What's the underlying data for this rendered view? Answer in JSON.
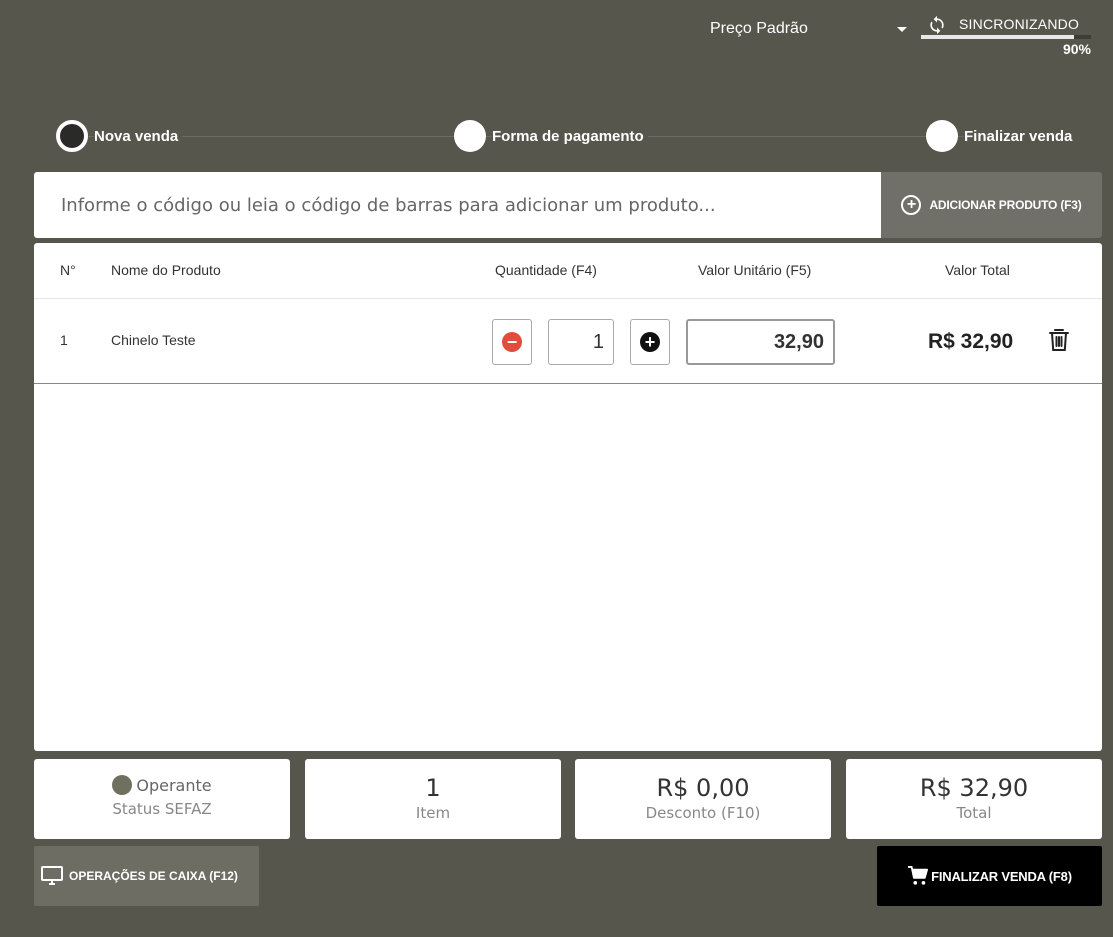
{
  "topbar": {
    "price_table": "Preço Padrão",
    "sync_label": "SINCRONIZANDO",
    "sync_percent_text": "90%",
    "sync_progress": 0.9
  },
  "steps": [
    {
      "label": "Nova venda",
      "active": true
    },
    {
      "label": "Forma de pagamento",
      "active": false
    },
    {
      "label": "Finalizar venda",
      "active": false
    }
  ],
  "search": {
    "placeholder": "Informe o código ou leia o código de barras para adicionar um produto...",
    "add_button_label": "ADICIONAR PRODUTO (F3)"
  },
  "table": {
    "headers": {
      "number": "N°",
      "name": "Nome do Produto",
      "quantity": "Quantidade (F4)",
      "unit_value": "Valor Unitário (F5)",
      "total_value": "Valor Total"
    },
    "rows": [
      {
        "number": "1",
        "name": "Chinelo Teste",
        "quantity": "1",
        "unit_value": "32,90",
        "total": "R$ 32,90"
      }
    ]
  },
  "summary": {
    "sefaz_status": "Operante",
    "sefaz_label": "Status SEFAZ",
    "items_count": "1",
    "items_label": "Item",
    "discount_value": "R$ 0,00",
    "discount_label": "Desconto (F10)",
    "total_value": "R$ 32,90",
    "total_label": "Total"
  },
  "actions": {
    "cash_ops_label": "OPERAÇÕES DE CAIXA (F12)",
    "finish_label": "FINALIZAR VENDA (F8)"
  },
  "colors": {
    "background": "#57564c",
    "minus_button": "#e04e3b",
    "finish_button": "#000000"
  }
}
